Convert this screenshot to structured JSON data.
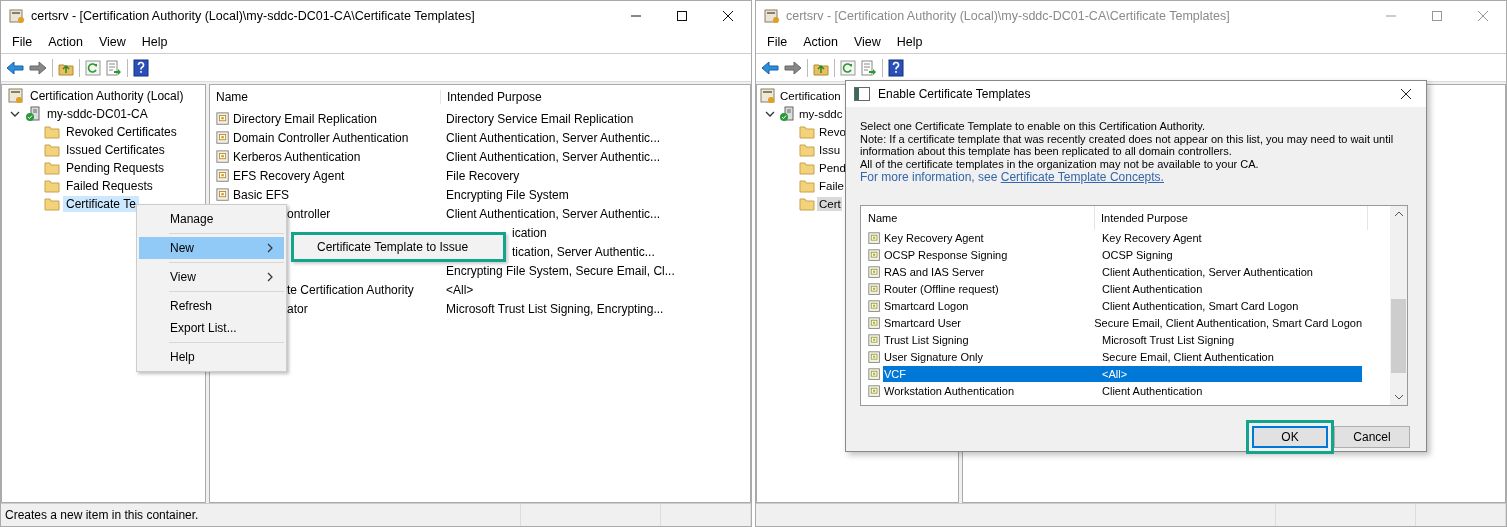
{
  "windows": [
    {
      "title": "certsrv - [Certification Authority (Local)\\my-sddc-DC01-CA\\Certificate Templates]",
      "active": true,
      "menu": [
        "File",
        "Action",
        "View",
        "Help"
      ],
      "tree": [
        {
          "label": "Certification Authority (Local)",
          "kind": "root",
          "selected": false,
          "children": [
            {
              "label": "my-sddc-DC01-CA",
              "kind": "server",
              "expanded": true,
              "selected": false,
              "children": [
                {
                  "label": "Revoked Certificates",
                  "kind": "folder",
                  "selected": false
                },
                {
                  "label": "Issued Certificates",
                  "kind": "folder",
                  "selected": false
                },
                {
                  "label": "Pending Requests",
                  "kind": "folder",
                  "selected": false
                },
                {
                  "label": "Failed Requests",
                  "kind": "folder",
                  "selected": false
                },
                {
                  "label": "Certificate Te",
                  "kind": "folder",
                  "selected": true
                }
              ]
            }
          ]
        }
      ],
      "list": {
        "columns": [
          "Name",
          "Intended Purpose"
        ],
        "rows": [
          {
            "kind": "whole",
            "name": "Directory Email Replication",
            "purpose": "Directory Service Email Replication"
          },
          {
            "kind": "whole",
            "name": "Domain Controller Authentication",
            "purpose": "Client Authentication, Server Authentic..."
          },
          {
            "kind": "whole",
            "name": "Kerberos Authentication",
            "purpose": "Client Authentication, Server Authentic..."
          },
          {
            "kind": "whole",
            "name": "EFS Recovery Agent",
            "purpose": "File Recovery"
          },
          {
            "kind": "whole",
            "name": "Basic EFS",
            "purpose": "Encrypting File System"
          },
          {
            "kind": "name_cut",
            "name": "ontroller",
            "purpose": "Client Authentication, Server Authentic..."
          },
          {
            "kind": "purpose_cut",
            "purpose": "ication"
          },
          {
            "kind": "purpose_cut",
            "purpose": "tication, Server Authentic..."
          },
          {
            "kind": "whole",
            "purpose": "Encrypting File System, Secure Email, Cl..."
          },
          {
            "kind": "name_cut",
            "name": "te Certification Authority",
            "purpose": "<All>"
          },
          {
            "kind": "name_cut",
            "name": "ator",
            "purpose": "Microsoft Trust List Signing, Encrypting..."
          }
        ]
      },
      "context_menu": {
        "items": [
          {
            "kind": "item",
            "label": "Manage",
            "selected": false,
            "submenu": false
          },
          {
            "kind": "separator"
          },
          {
            "kind": "item",
            "label": "New",
            "selected": true,
            "submenu": true
          },
          {
            "kind": "separator"
          },
          {
            "kind": "item",
            "label": "View",
            "selected": false,
            "submenu": true
          },
          {
            "kind": "separator"
          },
          {
            "kind": "item",
            "label": "Refresh",
            "selected": false,
            "submenu": false
          },
          {
            "kind": "item",
            "label": "Export List...",
            "selected": false,
            "submenu": false
          },
          {
            "kind": "separator"
          },
          {
            "kind": "item",
            "label": "Help",
            "selected": false,
            "submenu": false
          }
        ],
        "submenu": {
          "label": "Certificate Template to Issue",
          "annotated": true
        }
      },
      "status": "Creates a new item in this container."
    },
    {
      "title": "certsrv - [Certification Authority (Local)\\my-sddc-DC01-CA\\Certificate Templates]",
      "active": false,
      "menu": [
        "File",
        "Action",
        "View",
        "Help"
      ],
      "tree": [
        {
          "label": "Certification",
          "kind": "root",
          "selected": false,
          "children": [
            {
              "label": "my-sddc",
              "kind": "server",
              "expanded": true,
              "selected": false,
              "children": [
                {
                  "label": "Revo",
                  "kind": "folder",
                  "selected": false
                },
                {
                  "label": "Issu",
                  "kind": "folder",
                  "selected": false
                },
                {
                  "label": "Pend",
                  "kind": "folder",
                  "selected": false
                },
                {
                  "label": "Faile",
                  "kind": "folder",
                  "selected": false
                },
                {
                  "label": "Cert",
                  "kind": "folder",
                  "selected": true
                }
              ]
            }
          ]
        }
      ],
      "dialog": {
        "title": "Enable Certificate Templates",
        "paragraphs": [
          "Select one Certificate Template to enable on this Certification Authority.",
          "Note: If a certificate template that was recently created does not appear on this list, you may need to wait until information about this template has been replicated to all domain controllers.",
          "All of the certificate templates in the organization may not be available to your CA."
        ],
        "more_info": "For more information, see ",
        "link": "Certificate Template Concepts.",
        "columns": [
          "Name",
          "Intended Purpose"
        ],
        "rows": [
          {
            "name": "Key Recovery Agent",
            "purpose": "Key Recovery Agent",
            "selected": false
          },
          {
            "name": "OCSP Response Signing",
            "purpose": "OCSP Signing",
            "selected": false
          },
          {
            "name": "RAS and IAS Server",
            "purpose": "Client Authentication, Server Authentication",
            "selected": false
          },
          {
            "name": "Router (Offline request)",
            "purpose": "Client Authentication",
            "selected": false
          },
          {
            "name": "Smartcard Logon",
            "purpose": "Client Authentication, Smart Card Logon",
            "selected": false
          },
          {
            "name": "Smartcard User",
            "purpose": "Secure Email, Client Authentication, Smart Card Logon",
            "selected": false
          },
          {
            "name": "Trust List Signing",
            "purpose": "Microsoft Trust List Signing",
            "selected": false
          },
          {
            "name": "User Signature Only",
            "purpose": "Secure Email, Client Authentication",
            "selected": false
          },
          {
            "name": "VCF",
            "purpose": "<All>",
            "selected": true
          },
          {
            "name": "Workstation Authentication",
            "purpose": "Client Authentication",
            "selected": false
          }
        ],
        "buttons": [
          {
            "label": "OK",
            "annotated": true
          },
          {
            "label": "Cancel",
            "annotated": false
          }
        ]
      }
    }
  ]
}
